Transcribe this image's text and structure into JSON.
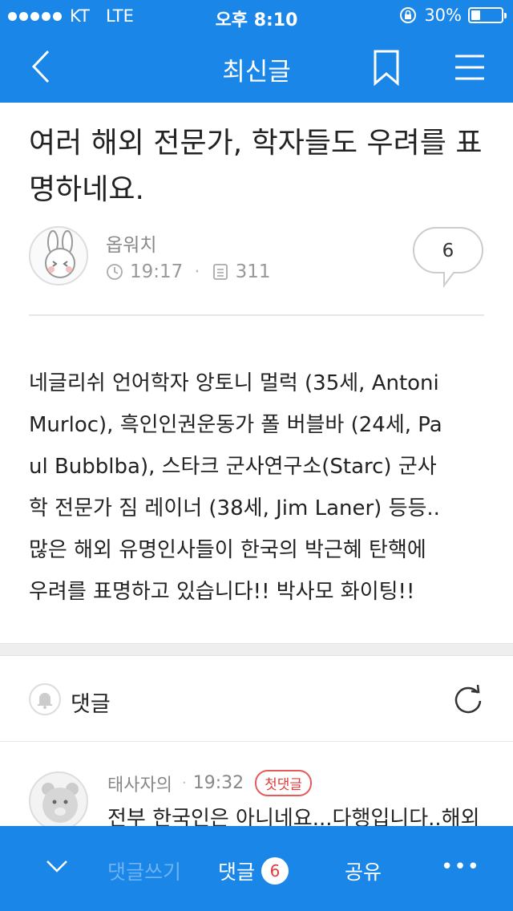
{
  "status_bar": {
    "carrier": "KT",
    "network": "LTE",
    "time": "오후 8:10",
    "battery_text": "30%",
    "battery_level": 0.3,
    "icons": [
      "signal-dots-icon",
      "rotation-lock-icon",
      "battery-icon"
    ]
  },
  "nav": {
    "title": "최신글",
    "icons": [
      "back-chevron-icon",
      "bookmark-icon",
      "hamburger-menu-icon"
    ]
  },
  "article": {
    "title": "여러 해외 전문가, 학자들도 우려를 표명하네요.",
    "author": "옵워치",
    "time": "19:17",
    "views": "311",
    "comment_count": "6",
    "body": "네글리쉬 언어학자 앙토니 멀럭 (35세, Antoni\nMurloc), 흑인인권운동가 폴 버블바 (24세, Pa\nul Bubblba), 스타크 군사연구소(Starc) 군사\n학 전문가 짐 레이너 (38세, Jim Laner) 등등..\n많은 해외 유명인사들이 한국의 박근혜 탄핵에\n우려를 표명하고 있습니다!! 박사모 화이팅!!"
  },
  "comments": {
    "header": "댓글",
    "items": [
      {
        "author": "태사자의",
        "time": "19:32",
        "badge": "첫댓글",
        "text": "전부 한국인은 아니네요...다행입니다..해외"
      }
    ]
  },
  "toolbar": {
    "write_label": "댓글쓰기",
    "comments_label": "댓글",
    "comments_badge": "6",
    "share_label": "공유",
    "more_label": "•••"
  },
  "colors": {
    "brand_blue": "#1a86e8",
    "badge_red": "#e03c3c"
  }
}
